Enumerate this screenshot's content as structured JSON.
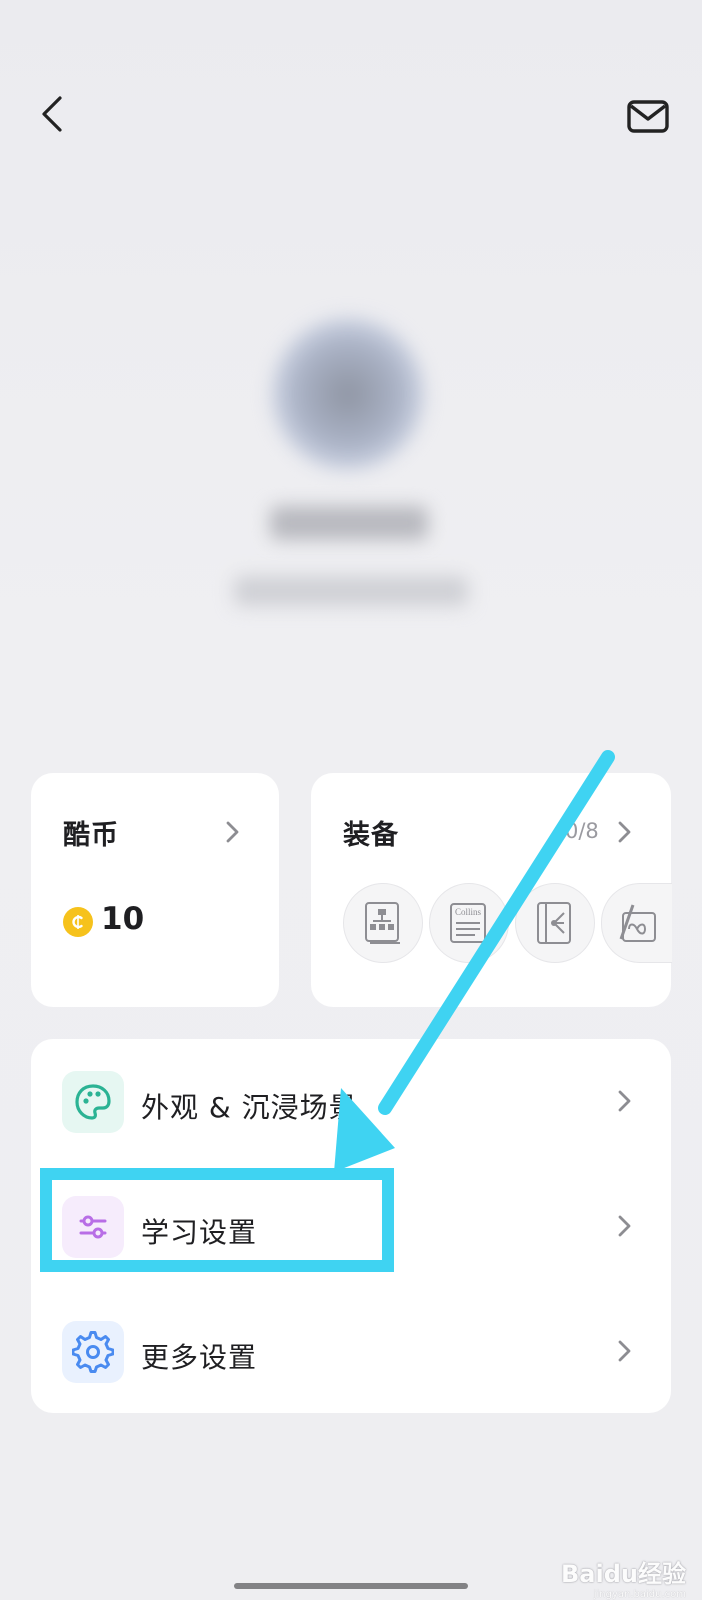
{
  "header": {
    "back_icon": "back-arrow-icon",
    "mail_icon": "mail-icon"
  },
  "coins_card": {
    "title": "酷币",
    "coin_icon": "coin-icon",
    "amount": "10",
    "coin_color": "#f6c21c"
  },
  "equipment_card": {
    "title": "装备",
    "count": "0/8",
    "items": [
      {
        "icon": "mindmap-book-icon"
      },
      {
        "icon": "collins-dictionary-icon",
        "label": "Collins"
      },
      {
        "icon": "tree-diagram-book-icon"
      },
      {
        "icon": "infinite-pencil-icon"
      }
    ]
  },
  "settings": {
    "rows": [
      {
        "label": "外观 & 沉浸场景",
        "icon": "palette-icon",
        "icon_color": "#2bb394"
      },
      {
        "label": "学习设置",
        "icon": "sliders-icon",
        "icon_color": "#b86ee6"
      },
      {
        "label": "更多设置",
        "icon": "gear-icon",
        "icon_color": "#4a8bf0"
      }
    ]
  },
  "annotation": {
    "highlight_color": "#3fd3f2"
  },
  "watermark": {
    "text": "Baidu经验",
    "subtext": "jingyan.baidu.com"
  }
}
